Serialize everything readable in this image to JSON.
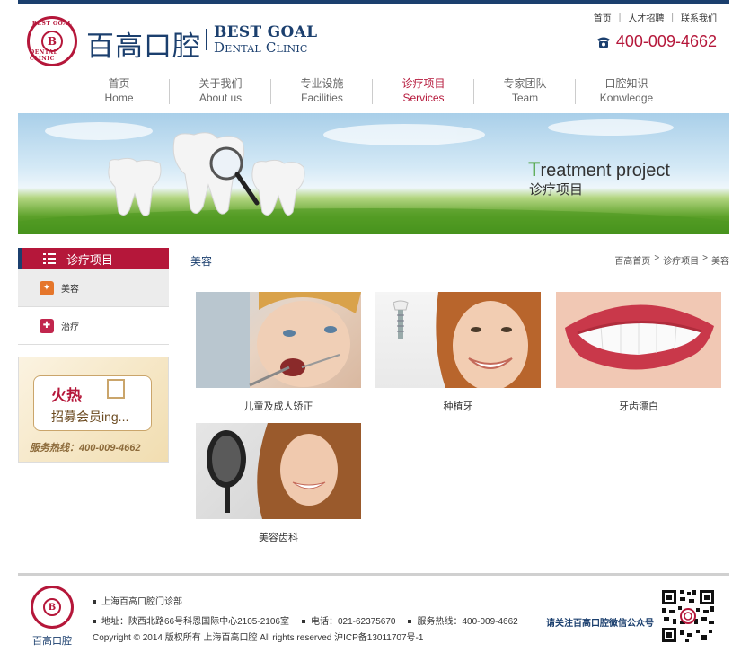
{
  "brand": {
    "seal_top": "BEST GOAL",
    "seal_mid": "B",
    "seal_bottom": "DENTAL CLINIC",
    "name_cn": "百高口腔",
    "name_en_1": "Best Goal",
    "name_en_2": "Dental Clinic"
  },
  "toplinks": [
    "首页",
    "人才招聘",
    "联系我们"
  ],
  "phone": "400-009-4662",
  "nav": [
    {
      "cn": "首页",
      "en": "Home",
      "active": false
    },
    {
      "cn": "关于我们",
      "en": "About us",
      "active": false
    },
    {
      "cn": "专业设施",
      "en": "Facilities",
      "active": false
    },
    {
      "cn": "诊疗项目",
      "en": "Services",
      "active": true
    },
    {
      "cn": "专家团队",
      "en": "Team",
      "active": false
    },
    {
      "cn": "口腔知识",
      "en": "Konwledge",
      "active": false
    }
  ],
  "banner": {
    "title_first": "T",
    "title_rest": "reatment project",
    "subtitle": "诊疗项目"
  },
  "sidebar": {
    "heading": "诊疗项目",
    "items": [
      {
        "label": "美容",
        "selected": true
      },
      {
        "label": "治疗",
        "selected": false
      }
    ],
    "promo": {
      "hot": "火热",
      "recruit": "招募会员ing...",
      "hotline": "服务热线：400-009-4662"
    }
  },
  "content": {
    "section_title": "美容",
    "breadcrumb": [
      "百高首页",
      "诊疗项目",
      "美容"
    ],
    "breadcrumb_sep": ">",
    "cards": [
      {
        "caption": "儿童及成人矫正"
      },
      {
        "caption": "种植牙"
      },
      {
        "caption": "牙齿漂白"
      },
      {
        "caption": "美容齿科"
      }
    ]
  },
  "footer": {
    "brand": "百高口腔",
    "clinic": "上海百高口腔门诊部",
    "address": "地址：陕西北路66号科恩国际中心2105-2106室",
    "tel": "电话：021-62375670",
    "hotline": "服务热线：400-009-4662",
    "copyright": "Copyright © 2014 版权所有 上海百高口腔 All rights reserved 沪ICP备13011707号-1",
    "wechat": "请关注百高口腔微信公众号"
  },
  "colors": {
    "brand_navy": "#1b3f6e",
    "brand_red": "#b5173a"
  }
}
